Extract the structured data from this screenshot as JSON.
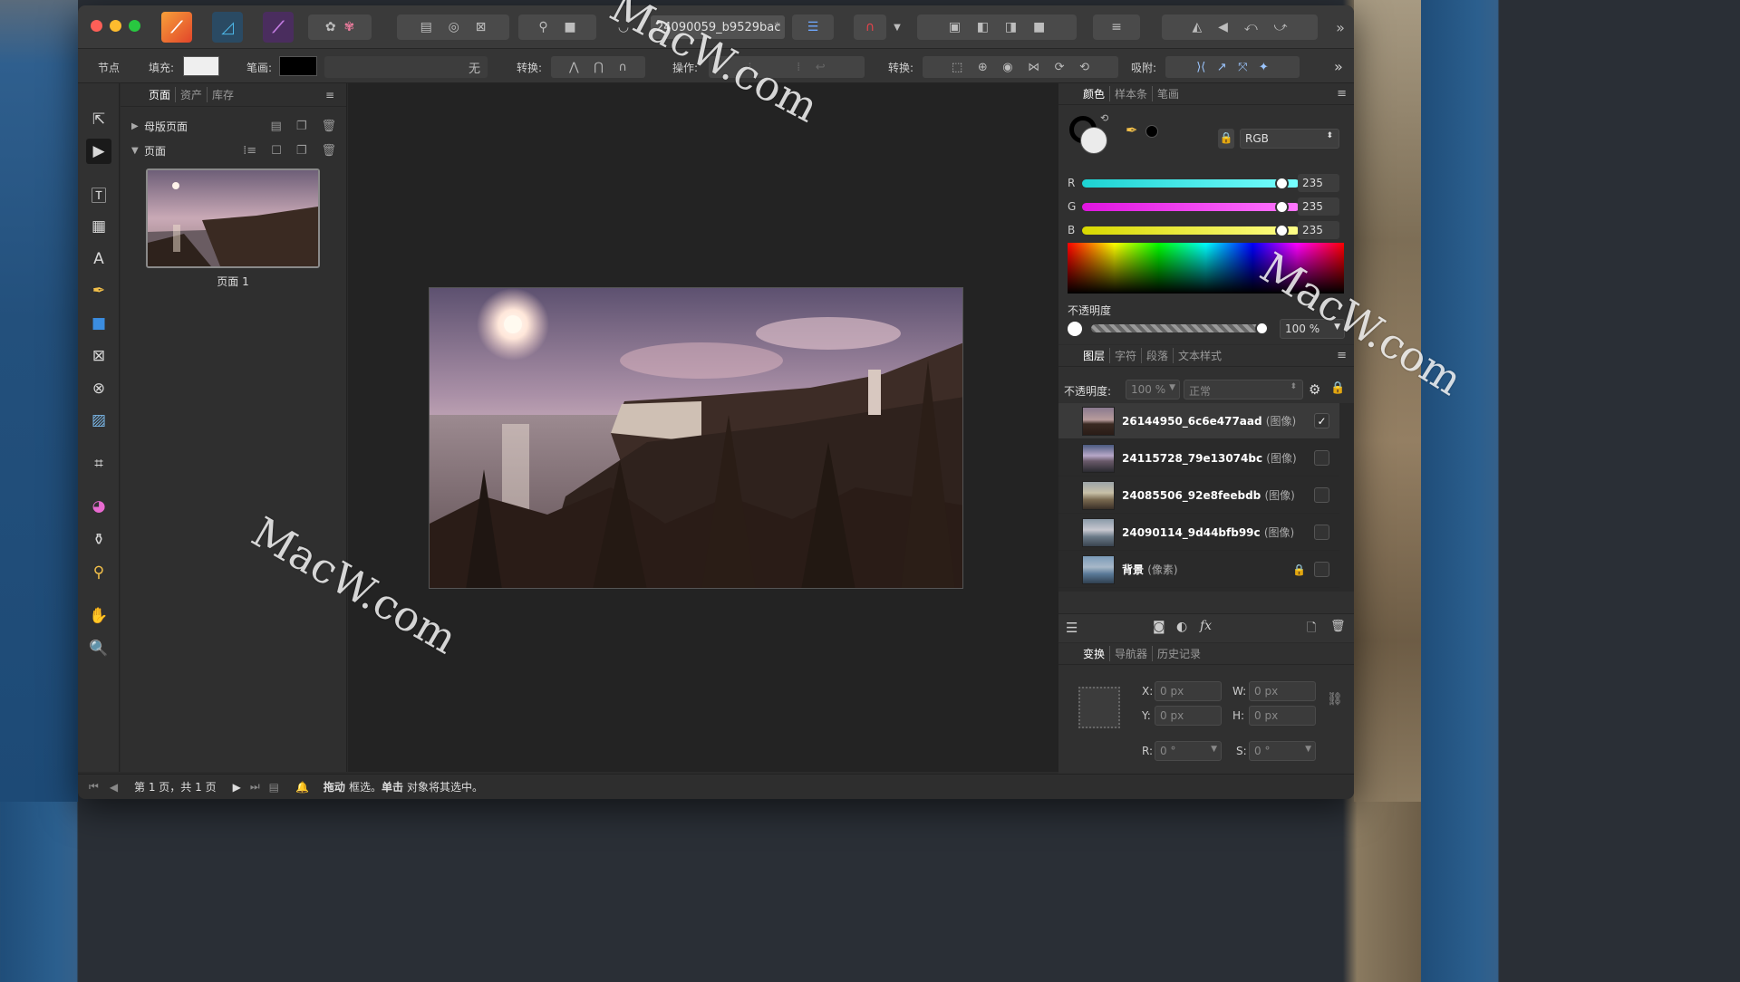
{
  "toolbar": {
    "document_tab": "24090059_b9529bac",
    "document_tab_close": "*",
    "more": "»"
  },
  "context_toolbar": {
    "node_label": "节点",
    "fill_label": "填充:",
    "stroke_label": "笔画:",
    "stroke_none": "无",
    "convert_label": "转换:",
    "action_label": "操作:",
    "transform_label": "转换:",
    "snap_label": "吸附:",
    "more": "»",
    "fill_color": "#efefef",
    "stroke_color": "#000000"
  },
  "pages_panel": {
    "tabs": [
      "页面",
      "资产",
      "库存"
    ],
    "master_pages": "母版页面",
    "pages": "页面",
    "page_thumb_label": "页面 1"
  },
  "color_panel": {
    "tabs": [
      "颜色",
      "样本条",
      "笔画"
    ],
    "model": "RGB",
    "channels": [
      {
        "label": "R",
        "value": "235",
        "fraction": 0.92
      },
      {
        "label": "G",
        "value": "235",
        "fraction": 0.92
      },
      {
        "label": "B",
        "value": "235",
        "fraction": 0.92
      }
    ],
    "opacity_label": "不透明度",
    "opacity_value": "100 %"
  },
  "layers_panel": {
    "tabs": [
      "图层",
      "字符",
      "段落",
      "文本样式"
    ],
    "opacity_label": "不透明度:",
    "opacity_value": "100 %",
    "blend_mode": "正常",
    "layers": [
      {
        "name": "26144950_6c6e477aad",
        "type": "(图像)",
        "checked": "✓"
      },
      {
        "name": "24115728_79e13074bc",
        "type": "(图像)",
        "checked": ""
      },
      {
        "name": "24085506_92e8feebdb",
        "type": "(图像)",
        "checked": ""
      },
      {
        "name": "24090114_9d44bfb99c",
        "type": "(图像)",
        "checked": ""
      },
      {
        "name": "背景",
        "type": "(像素)",
        "checked": ""
      }
    ]
  },
  "transform_panel": {
    "tabs": [
      "变换",
      "导航器",
      "历史记录"
    ],
    "x_label": "X:",
    "x_value": "0 px",
    "y_label": "Y:",
    "y_value": "0 px",
    "w_label": "W:",
    "w_value": "0 px",
    "h_label": "H:",
    "h_value": "0 px",
    "r_label": "R:",
    "r_value": "0 °",
    "s_label": "S:",
    "s_value": "0 °"
  },
  "statusbar": {
    "page_info": "第 1 页，共 1 页",
    "hint_bold1": "拖动",
    "hint1": "框选。",
    "hint_bold2": "单击",
    "hint2": "对象将其选中。"
  },
  "watermarks": [
    "MacW.com",
    "MacW.com",
    "MacW.com"
  ]
}
